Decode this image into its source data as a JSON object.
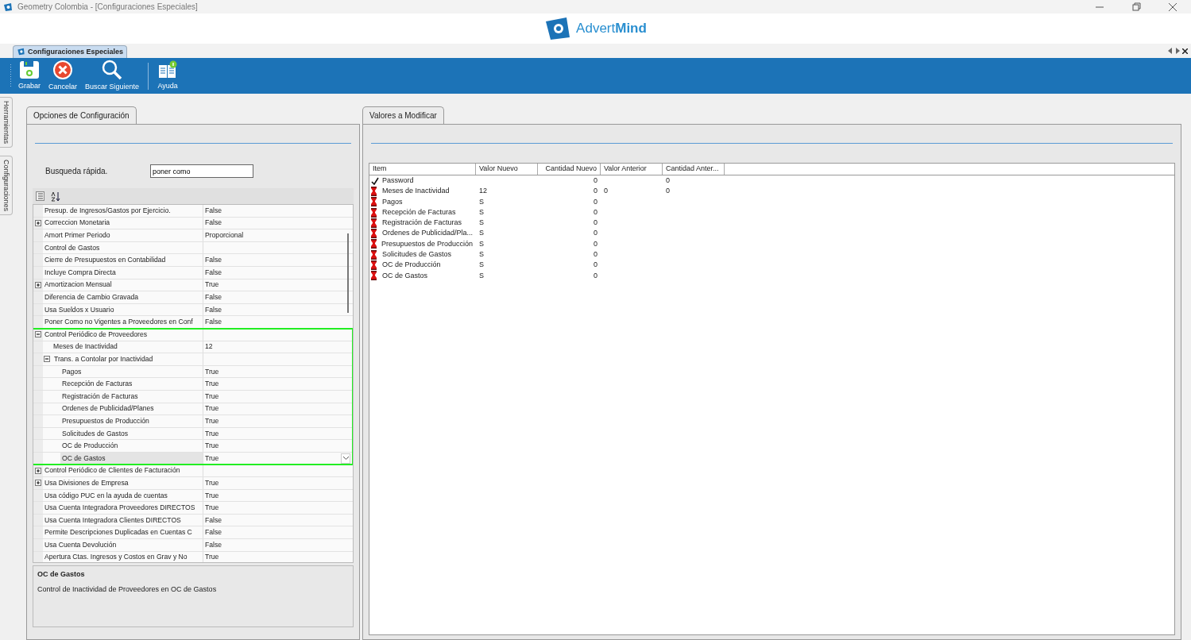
{
  "window": {
    "title": "Geometry Colombia - [Configuraciones Especiales]"
  },
  "logo": {
    "text": "Advert**Mind**"
  },
  "doc_tab": {
    "label": "Configuraciones Especiales",
    "selected": true
  },
  "toolbar": [
    {
      "label": "Grabar",
      "kind": "save"
    },
    {
      "label": "Cancelar",
      "kind": "cancel"
    },
    {
      "label": "Buscar Siguiente",
      "kind": "search"
    },
    {
      "label": "Ayuda",
      "kind": "help"
    }
  ],
  "side_tabs": [
    {
      "label": "Herramientas"
    },
    {
      "label": "Configuraciones"
    }
  ],
  "left_panel": {
    "tab": "Opciones de Configuración",
    "search_label": "Busqueda rápida.",
    "search_value": "poner como",
    "rows": [
      {
        "name": "Presup. de Ingresos/Gastos por Ejercicio.",
        "value": "False",
        "selected": false
      },
      {
        "name": "Correccion Monetaria",
        "value": "False",
        "expanded": false,
        "selected": false
      },
      {
        "name": "Amort Primer Periodo",
        "value": "Proporcional",
        "selected": false
      },
      {
        "name": "Control de Gastos",
        "selected": false
      },
      {
        "name": "Cierre de Presupuestos en Contabilidad",
        "value": "False",
        "selected": false
      },
      {
        "name": "Incluye Compra Directa",
        "value": "False",
        "selected": false
      },
      {
        "name": "Amortizacion Mensual",
        "value": "True",
        "expanded": false,
        "selected": false
      },
      {
        "name": "Diferencia de Cambio Gravada",
        "value": "False",
        "selected": false
      },
      {
        "name": "Usa Sueldos x Usuario",
        "value": "False",
        "selected": false
      },
      {
        "name": "Poner Como no Vigentes a Proveedores en Conf",
        "value": "False",
        "selected": false
      },
      {
        "name": "Control Periódico de Proveedores",
        "expanded": true,
        "selected": false,
        "highlighted": true,
        "children": [
          {
            "name": "Meses de Inactividad",
            "value": "12",
            "selected": false
          },
          {
            "name": "Trans. a Contolar por Inactividad",
            "expanded": true,
            "selected": false,
            "children": [
              {
                "name": "Pagos",
                "value": "True",
                "selected": false
              },
              {
                "name": "Recepción de Facturas",
                "value": "True",
                "selected": false
              },
              {
                "name": "Registración de Facturas",
                "value": "True",
                "selected": false
              },
              {
                "name": "Ordenes de Publicidad/Planes",
                "value": "True",
                "selected": false
              },
              {
                "name": "Presupuestos de Producción",
                "value": "True",
                "selected": false
              },
              {
                "name": "Solicitudes de Gastos",
                "value": "True",
                "selected": false
              },
              {
                "name": "OC de Producción",
                "value": "True",
                "selected": false
              },
              {
                "name": "OC de Gastos",
                "value": "True",
                "selected": true
              }
            ]
          }
        ]
      },
      {
        "name": "Control Periódico de Clientes de Facturación",
        "expanded": false,
        "selected": false
      },
      {
        "name": "Usa Divisiones de Empresa",
        "value": "True",
        "expanded": false,
        "selected": false
      },
      {
        "name": "Usa código PUC en la ayuda de cuentas",
        "value": "True",
        "selected": false
      },
      {
        "name": "Usa Cuenta Integradora Proveedores DIRECTOS",
        "value": "True",
        "selected": false
      },
      {
        "name": "Usa Cuenta Integradora Clientes DIRECTOS",
        "value": "False",
        "selected": false
      },
      {
        "name": "Permite Descripciones Duplicadas en Cuentas C",
        "value": "False",
        "selected": false
      },
      {
        "name": "Usa Cuenta Devolución",
        "value": "False",
        "selected": false
      },
      {
        "name": "Apertura Ctas. Ingresos y Costos en Grav y No",
        "value": "True",
        "selected": false
      }
    ],
    "help_title": "OC de Gastos",
    "help_text": "Control de Inactividad de Proveedores en OC de Gastos"
  },
  "right_panel": {
    "tab": "Valores a Modificar",
    "columns": [
      "Item",
      "Valor Nuevo",
      "Cantidad Nuevo",
      "Valor Anterior",
      "Cantidad Anter..."
    ],
    "rows": [
      {
        "kind": "ok",
        "cells": [
          "Password",
          "",
          "0",
          "",
          "0"
        ]
      },
      {
        "kind": "alert",
        "cells": [
          "Meses de Inactividad",
          "12",
          "0",
          "0",
          "0"
        ]
      },
      {
        "kind": "alert",
        "cells": [
          "Pagos",
          "S",
          "0",
          "",
          ""
        ]
      },
      {
        "kind": "alert",
        "cells": [
          "Recepción de Facturas",
          "S",
          "0",
          "",
          ""
        ]
      },
      {
        "kind": "alert",
        "cells": [
          "Registración de Facturas",
          "S",
          "0",
          "",
          ""
        ]
      },
      {
        "kind": "alert",
        "cells": [
          "Ordenes de Publicidad/Pla...",
          "S",
          "0",
          "",
          ""
        ]
      },
      {
        "kind": "alert",
        "cells": [
          "Presupuestos de Producción",
          "S",
          "0",
          "",
          ""
        ]
      },
      {
        "kind": "alert",
        "cells": [
          "Solicitudes de Gastos",
          "S",
          "0",
          "",
          ""
        ]
      },
      {
        "kind": "alert",
        "cells": [
          "OC de Producción",
          "S",
          "0",
          "",
          ""
        ]
      },
      {
        "kind": "alert",
        "cells": [
          "OC de Gastos",
          "S",
          "0",
          "",
          ""
        ]
      }
    ]
  }
}
